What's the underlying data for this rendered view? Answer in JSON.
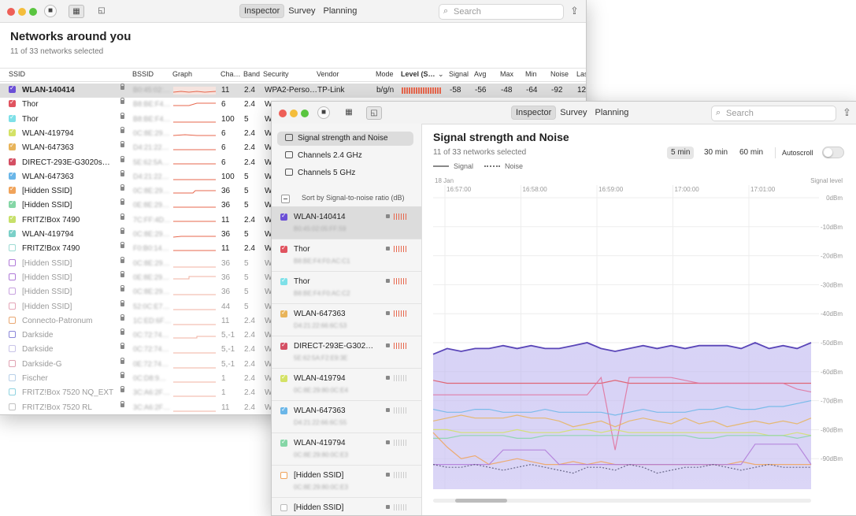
{
  "left_window": {
    "toolbar": {
      "tabs": [
        "Inspector",
        "Survey",
        "Planning"
      ],
      "active_tab": "Inspector",
      "search_placeholder": "Search"
    },
    "title": "Networks around you",
    "subtitle": "11 of 33 networks selected",
    "columns": [
      "SSID",
      "BSSID",
      "Graph",
      "Cha…",
      "Band",
      "Security",
      "Vendor",
      "Mode",
      "Level (S…",
      "Signal",
      "Avg",
      "Max",
      "Min",
      "Noise",
      "Las"
    ],
    "rows": [
      {
        "ssid": "WLAN-140414",
        "bssid": "B0:45:02:…",
        "ch": "11",
        "band": "2.4",
        "security": "WPA2-Perso…",
        "vendor": "TP-Link",
        "mode": "b/g/n",
        "signal": "-58",
        "avg": "-56",
        "max": "-48",
        "min": "-64",
        "noise": "-92",
        "last": "12",
        "checked": true,
        "color": "#6b4fd6",
        "bold": true,
        "selected": true
      },
      {
        "ssid": "Thor",
        "bssid": "B8:BE:F4…",
        "ch": "6",
        "band": "2.4",
        "security": "W",
        "checked": true,
        "color": "#e0535f"
      },
      {
        "ssid": "Thor",
        "bssid": "B8:BE:F4…",
        "ch": "100",
        "band": "5",
        "security": "W",
        "checked": true,
        "color": "#7ee0e8"
      },
      {
        "ssid": "WLAN-419794",
        "bssid": "0C:8E:29…",
        "ch": "6",
        "band": "2.4",
        "security": "W",
        "checked": true,
        "color": "#d4e266"
      },
      {
        "ssid": "WLAN-647363",
        "bssid": "D4:21:22…",
        "ch": "6",
        "band": "2.4",
        "security": "W",
        "checked": true,
        "color": "#e8b45a"
      },
      {
        "ssid": "DIRECT-293E-G3020s…",
        "bssid": "5E:62:5A…",
        "ch": "6",
        "band": "2.4",
        "security": "W",
        "checked": true,
        "color": "#d44f63"
      },
      {
        "ssid": "WLAN-647363",
        "bssid": "D4:21:22…",
        "ch": "100",
        "band": "5",
        "security": "W",
        "checked": true,
        "color": "#6ab6e8"
      },
      {
        "ssid": "[Hidden SSID]",
        "bssid": "0C:8E:29…",
        "ch": "36",
        "band": "5",
        "security": "W",
        "checked": true,
        "color": "#f0a35a"
      },
      {
        "ssid": "[Hidden SSID]",
        "bssid": "0E:8E:29…",
        "ch": "36",
        "band": "5",
        "security": "W",
        "checked": true,
        "color": "#85d6a6"
      },
      {
        "ssid": "FRITZ!Box 7490",
        "bssid": "7C:FF:4D…",
        "ch": "11",
        "band": "2.4",
        "security": "W",
        "checked": true,
        "color": "#c7e06a"
      },
      {
        "ssid": "WLAN-419794",
        "bssid": "0C:8E:29…",
        "ch": "36",
        "band": "5",
        "security": "W",
        "checked": true,
        "color": "#7bd0c8"
      },
      {
        "ssid": "FRITZ!Box 7490",
        "bssid": "F0:B0:14…",
        "ch": "11",
        "band": "2.4",
        "security": "W",
        "checked": false,
        "color": "#9edbd4"
      },
      {
        "ssid": "[Hidden SSID]",
        "bssid": "0C:8E:29…",
        "ch": "36",
        "band": "5",
        "security": "W",
        "checked": false,
        "color": "#b07ad8",
        "dim": true
      },
      {
        "ssid": "[Hidden SSID]",
        "bssid": "0E:8E:29…",
        "ch": "36",
        "band": "5",
        "security": "W",
        "checked": false,
        "color": "#b07ad8",
        "dim": true
      },
      {
        "ssid": "[Hidden SSID]",
        "bssid": "0C:8E:29…",
        "ch": "36",
        "band": "5",
        "security": "W",
        "checked": false,
        "color": "#c8a2e0",
        "dim": true
      },
      {
        "ssid": "[Hidden SSID]",
        "bssid": "52:0C:E7…",
        "ch": "44",
        "band": "5",
        "security": "W",
        "checked": false,
        "color": "#e4a6b8",
        "dim": true
      },
      {
        "ssid": "Connecto-Patronum",
        "bssid": "1C:ED:6F…",
        "ch": "11",
        "band": "2.4",
        "security": "W",
        "checked": false,
        "color": "#e9a873",
        "dim": true
      },
      {
        "ssid": "Darkside",
        "bssid": "0C:72:74…",
        "ch": "5,-1",
        "band": "2.4",
        "security": "W",
        "checked": false,
        "color": "#8a86d8",
        "dim": true
      },
      {
        "ssid": "Darkside",
        "bssid": "0C:72:74…",
        "ch": "5,-1",
        "band": "2.4",
        "security": "W",
        "checked": false,
        "color": "#c9c4e8",
        "dim": true
      },
      {
        "ssid": "Darkside-G",
        "bssid": "0E:72:74…",
        "ch": "5,-1",
        "band": "2.4",
        "security": "W",
        "checked": false,
        "color": "#e0a2b2",
        "dim": true
      },
      {
        "ssid": "Fischer",
        "bssid": "0C:D8:9…",
        "ch": "1",
        "band": "2.4",
        "security": "W",
        "checked": false,
        "color": "#b8d0e8",
        "dim": true
      },
      {
        "ssid": "FRITZ!Box 7520 NQ_EXT",
        "bssid": "3C:A6:2F…",
        "ch": "1",
        "band": "2.4",
        "security": "W",
        "checked": false,
        "color": "#8fd3e0",
        "dim": true
      },
      {
        "ssid": "FRITZ!Box 7520 RL",
        "bssid": "3C:A6:2F…",
        "ch": "11",
        "band": "2.4",
        "security": "W",
        "checked": false,
        "color": "#c2c2c2",
        "dim": true
      }
    ]
  },
  "right_window": {
    "toolbar": {
      "tabs": [
        "Inspector",
        "Survey",
        "Planning"
      ],
      "active_tab": "Inspector",
      "search_placeholder": "Search"
    },
    "sidebar": {
      "nav": [
        "Signal strength and Noise",
        "Channels 2.4 GHz",
        "Channels 5 GHz"
      ],
      "sort_label": "Sort by Signal-to-noise ratio (dB)",
      "cards": [
        {
          "name": "WLAN-140414",
          "bssid": "B0:45:02:05:FF:59",
          "color": "#6b4fd6",
          "checked": true,
          "selected": true,
          "strength": "part"
        },
        {
          "name": "Thor",
          "bssid": "B8:BE:F4:F0:AC:C1",
          "color": "#e0535f",
          "checked": true,
          "strength": "part"
        },
        {
          "name": "Thor",
          "bssid": "B8:BE:F4:F0:AC:C2",
          "color": "#7ee0e8",
          "checked": true,
          "strength": "part"
        },
        {
          "name": "WLAN-647363",
          "bssid": "D4:21:22:66:6C:53",
          "color": "#e8b45a",
          "checked": true,
          "strength": "part"
        },
        {
          "name": "DIRECT-293E-G302…",
          "bssid": "5E:62:5A:F2:E9:3E",
          "color": "#d44f63",
          "checked": true,
          "strength": "part"
        },
        {
          "name": "WLAN-419794",
          "bssid": "0C:8E:29:80:0C:E4",
          "color": "#d4e266",
          "checked": true,
          "strength": "low"
        },
        {
          "name": "WLAN-647363",
          "bssid": "D4:21:22:66:6C:55",
          "color": "#6ab6e8",
          "checked": true,
          "strength": "low"
        },
        {
          "name": "WLAN-419794",
          "bssid": "0C:8E:29:80:0C:E3",
          "color": "#85d6a6",
          "checked": true,
          "strength": "low"
        },
        {
          "name": "[Hidden SSID]",
          "bssid": "0C:8E:29:80:0C:E3",
          "color": "#f0a35a",
          "checked": false,
          "strength": "low"
        },
        {
          "name": "[Hidden SSID]",
          "bssid": "",
          "color": "#bbbbbb",
          "checked": false,
          "strength": "low"
        }
      ]
    },
    "main": {
      "title": "Signal strength and Noise",
      "subtitle": "11 of 33 networks selected",
      "legend": [
        "Signal",
        "Noise"
      ],
      "ranges": [
        "5 min",
        "30 min",
        "60 min"
      ],
      "active_range": "5 min",
      "autoscroll_label": "Autoscroll"
    },
    "chart_data": {
      "type": "line",
      "date_label": "18 Jan",
      "x": [
        "16:57:00",
        "16:58:00",
        "16:59:00",
        "17:00:00",
        "17:01:00"
      ],
      "ylabel": "Signal level",
      "y_ticks": [
        "0dBm",
        "-10dBm",
        "-20dBm",
        "-30dBm",
        "-40dBm",
        "-50dBm",
        "-60dBm",
        "-70dBm",
        "-80dBm",
        "-90dBm"
      ],
      "ylim": [
        -100,
        0
      ],
      "series": [
        {
          "color": "#5a46b8",
          "values": [
            -54,
            -52,
            -53,
            -52,
            -52,
            -51,
            -52,
            -51,
            -52,
            -52,
            -51,
            -50,
            -52,
            -53,
            -52,
            -51,
            -52,
            -51,
            -52,
            -51,
            -51,
            -51,
            -52,
            -50,
            -52,
            -51,
            -52,
            -50
          ]
        },
        {
          "color": "#e0535f",
          "values": [
            -63,
            -64,
            -64,
            -64,
            -64,
            -64,
            -64,
            -64,
            -64,
            -64,
            -64,
            -64,
            -64,
            -63,
            -64,
            -64,
            -64,
            -64,
            -64,
            -64,
            -64,
            -64,
            -64,
            -64,
            -64,
            -64,
            -64,
            -64
          ]
        },
        {
          "color": "#e0709a",
          "values": [
            -68,
            -68,
            -68,
            -68,
            -68,
            -68,
            -68,
            -68,
            -68,
            -68,
            -68,
            -68,
            -62,
            -87,
            -62,
            -62,
            -62,
            -62,
            -63,
            -64,
            -64,
            -64,
            -64,
            -64,
            -64,
            -64,
            -66,
            -67
          ]
        },
        {
          "color": "#6ab6e8",
          "values": [
            -73,
            -74,
            -74,
            -73,
            -73,
            -74,
            -74,
            -74,
            -73,
            -74,
            -74,
            -74,
            -74,
            -75,
            -74,
            -73,
            -74,
            -74,
            -74,
            -73,
            -73,
            -72,
            -73,
            -73,
            -72,
            -72,
            -71,
            -70
          ]
        },
        {
          "color": "#e8b45a",
          "values": [
            -77,
            -76,
            -75,
            -76,
            -76,
            -76,
            -75,
            -76,
            -76,
            -77,
            -79,
            -78,
            -77,
            -79,
            -77,
            -76,
            -77,
            -78,
            -76,
            -78,
            -77,
            -79,
            -78,
            -77,
            -78,
            -77,
            -78,
            -76
          ]
        },
        {
          "color": "#d4e266",
          "values": [
            -80,
            -80,
            -81,
            -81,
            -81,
            -81,
            -80,
            -81,
            -81,
            -81,
            -80,
            -80,
            -81,
            -80,
            -81,
            -81,
            -81,
            -81,
            -81,
            -81,
            -81,
            -81,
            -81,
            -81,
            -82,
            -82,
            -81,
            -82
          ]
        },
        {
          "color": "#85d6a6",
          "values": [
            -83,
            -83,
            -82,
            -82,
            -82,
            -82,
            -83,
            -83,
            -82,
            -82,
            -82,
            -82,
            -82,
            -82,
            -82,
            -82,
            -82,
            -82,
            -82,
            -83,
            -83,
            -82,
            -82,
            -82,
            -82,
            -82,
            -83,
            -82
          ]
        },
        {
          "color": "#f0a35a",
          "values": [
            -81,
            -86,
            -90,
            -89,
            -92,
            -91,
            -90,
            -91,
            -92,
            -92,
            -91,
            -92,
            -91,
            -92,
            -92,
            -92,
            -92,
            -92,
            -92,
            -92,
            -92,
            -92,
            -91,
            -92,
            -92,
            -92,
            -92,
            -92
          ]
        },
        {
          "color": "#b07ad8",
          "values": [
            -92,
            -92,
            -92,
            -92,
            -92,
            -87,
            -87,
            -87,
            -87,
            -92,
            -92,
            -92,
            -92,
            -92,
            -92,
            -92,
            -92,
            -92,
            -92,
            -92,
            -92,
            -92,
            -92,
            -85,
            -85,
            -85,
            -85,
            -92
          ]
        },
        {
          "color": "#555577",
          "dashed": true,
          "values": [
            -92,
            -93,
            -93,
            -92,
            -93,
            -94,
            -93,
            -92,
            -93,
            -94,
            -95,
            -93,
            -93,
            -94,
            -92,
            -93,
            -95,
            -94,
            -93,
            -93,
            -92,
            -93,
            -94,
            -93,
            -92,
            -93,
            -93,
            -93
          ]
        }
      ]
    }
  }
}
